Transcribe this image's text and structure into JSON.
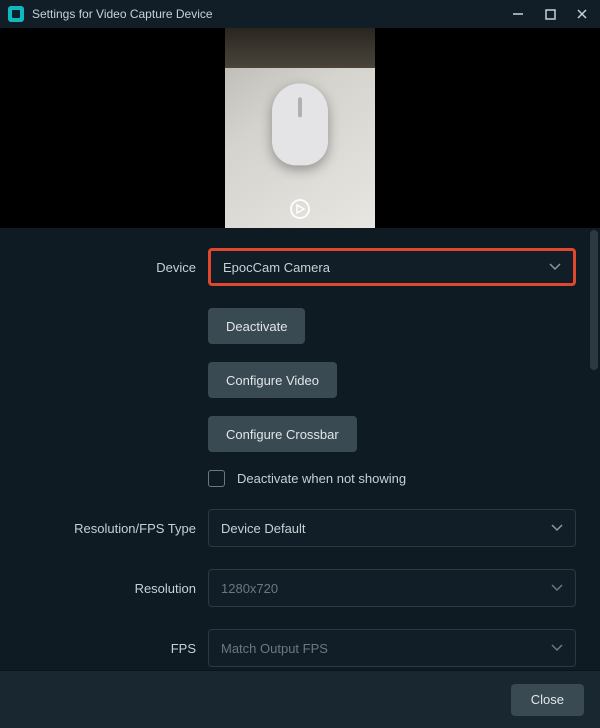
{
  "window": {
    "title": "Settings for Video Capture Device"
  },
  "form": {
    "device": {
      "label": "Device",
      "value": "EpocCam Camera"
    },
    "deactivate_btn": "Deactivate",
    "configure_video_btn": "Configure Video",
    "configure_crossbar_btn": "Configure Crossbar",
    "deactivate_checkbox_label": "Deactivate when not showing",
    "res_type": {
      "label": "Resolution/FPS Type",
      "value": "Device Default"
    },
    "resolution": {
      "label": "Resolution",
      "value": "1280x720"
    },
    "fps": {
      "label": "FPS",
      "value": "Match Output FPS"
    }
  },
  "footer": {
    "close": "Close"
  }
}
